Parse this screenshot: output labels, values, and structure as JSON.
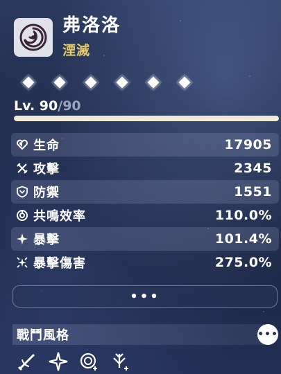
{
  "character": {
    "name": "弗洛洛",
    "element": "湮滅",
    "element_icon": "spiral-element-icon",
    "accent_color": "#e8c96a"
  },
  "sequence": {
    "count": 6,
    "icon": "diamond-node-icon"
  },
  "level": {
    "prefix": "Lv. ",
    "current": "90",
    "separator": "/",
    "max": "90",
    "progress": 1.0
  },
  "stats": [
    {
      "icon": "heart-icon",
      "label": "生命",
      "value": "17905"
    },
    {
      "icon": "crossed-swords-icon",
      "label": "攻擊",
      "value": "2345"
    },
    {
      "icon": "shield-icon",
      "label": "防禦",
      "value": "1551"
    },
    {
      "icon": "resonance-icon",
      "label": "共鳴效率",
      "value": "110.0%"
    },
    {
      "icon": "crit-star-icon",
      "label": "暴擊",
      "value": "101.4%"
    },
    {
      "icon": "crit-damage-icon",
      "label": "暴擊傷害",
      "value": "275.0%"
    }
  ],
  "more_button": {
    "label": "•••"
  },
  "combat_style": {
    "title": "戰鬥風格",
    "more_label": "•••",
    "skills": [
      "slash-skill-icon",
      "star-skill-icon",
      "spiral-plus-skill-icon",
      "burst-plus-skill-icon"
    ]
  }
}
